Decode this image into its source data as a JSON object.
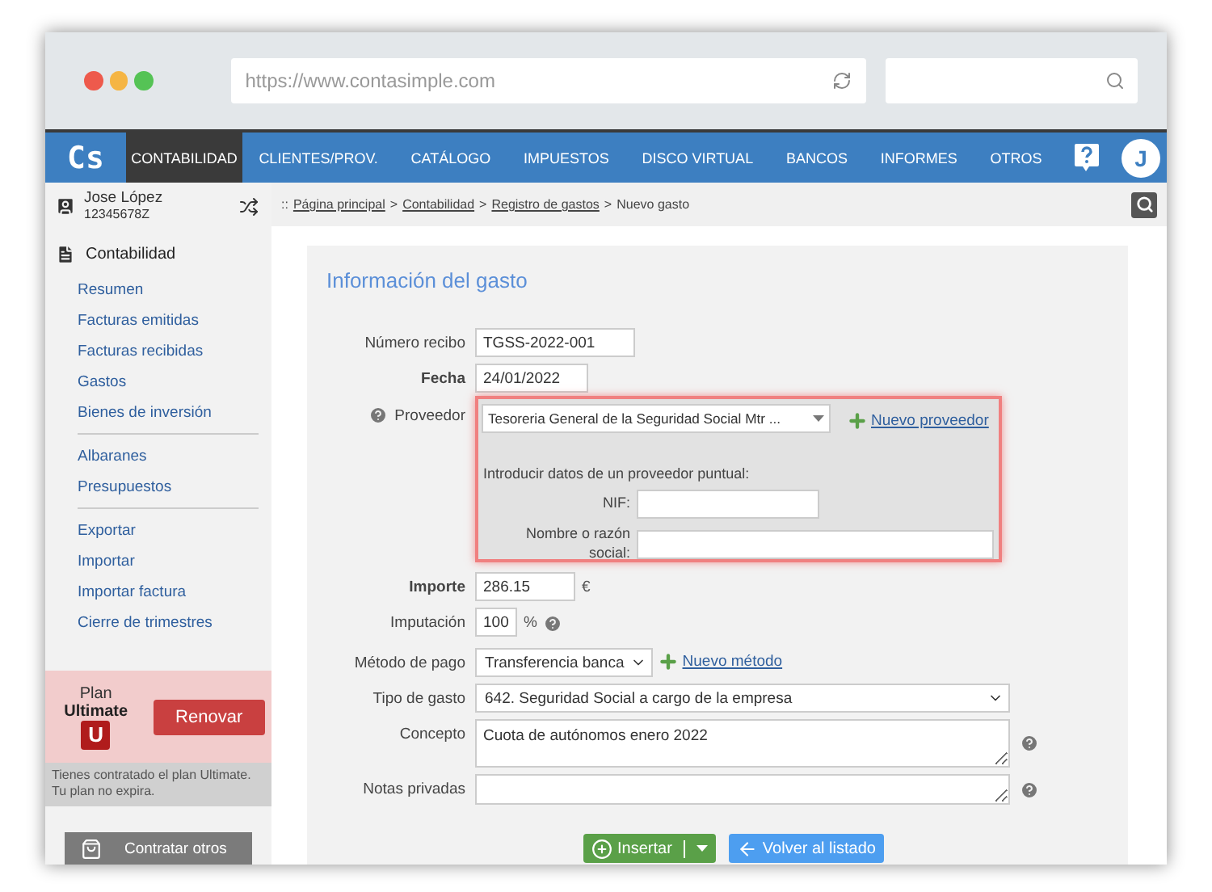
{
  "browser": {
    "url": "https://www.contasimple.com"
  },
  "nav": {
    "logo": "Cs",
    "items": [
      {
        "label": "CONTABILIDAD",
        "selected": true
      },
      {
        "label": "CLIENTES/PROV.",
        "selected": false
      },
      {
        "label": "CATÁLOGO",
        "selected": false
      },
      {
        "label": "IMPUESTOS",
        "selected": false
      },
      {
        "label": "DISCO VIRTUAL",
        "selected": false
      },
      {
        "label": "BANCOS",
        "selected": false
      },
      {
        "label": "INFORMES",
        "selected": false
      },
      {
        "label": "OTROS",
        "selected": false
      }
    ],
    "avatar": "J"
  },
  "user": {
    "name": "Jose López",
    "id": "12345678Z"
  },
  "sidebar": {
    "section": "Contabilidad",
    "groups": [
      [
        "Resumen",
        "Facturas emitidas",
        "Facturas recibidas",
        "Gastos",
        "Bienes de inversión"
      ],
      [
        "Albaranes",
        "Presupuestos"
      ],
      [
        "Exportar",
        "Importar",
        "Importar factura",
        "Cierre de trimestres"
      ]
    ]
  },
  "plan": {
    "label": "Plan",
    "name": "Ultimate",
    "badge": "U",
    "button": "Renovar",
    "note": "Tienes contratado el plan Ultimate. Tu plan no expira.",
    "contract": "Contratar otros"
  },
  "breadcrumb": {
    "prefix": "::",
    "separator": ">",
    "items": [
      {
        "label": "Página principal",
        "kind": "link"
      },
      {
        "label": "Contabilidad",
        "kind": "link"
      },
      {
        "label": "Registro de gastos",
        "kind": "link"
      },
      {
        "label": "Nuevo gasto",
        "kind": "current"
      }
    ]
  },
  "form": {
    "title": "Información del gasto",
    "fields": [
      {
        "label": "Número recibo",
        "bold": false,
        "kind": "text",
        "value": "TGSS-2022-001"
      },
      {
        "label": "Fecha",
        "bold": true,
        "kind": "date",
        "value": "24/01/2022"
      },
      {
        "label": "Proveedor",
        "bold": false,
        "kind": "provider",
        "help_icon": true,
        "value": "Tesoreria General de la Seguridad Social Mtr ...",
        "link": "Nuevo proveedor",
        "intro": "Introducir datos de un proveedor puntual:",
        "nif_label": "NIF:",
        "name_label": "Nombre o razón social:"
      },
      {
        "label": "Importe",
        "bold": true,
        "kind": "amount",
        "value": "286.15",
        "suffix": "€"
      },
      {
        "label": "Imputación",
        "bold": false,
        "kind": "percent",
        "value": "100",
        "suffix": "%",
        "help_icon": true
      },
      {
        "label": "Método de pago",
        "bold": false,
        "kind": "select-small",
        "value": "Transferencia banca",
        "link": "Nuevo método"
      },
      {
        "label": "Tipo de gasto",
        "bold": false,
        "kind": "select-wide",
        "value": "642. Seguridad Social a cargo de la empresa"
      },
      {
        "label": "Concepto",
        "bold": false,
        "kind": "textarea",
        "value": "Cuota de autónomos enero 2022",
        "help_icon": true
      },
      {
        "label": "Notas privadas",
        "bold": false,
        "kind": "textarea-small",
        "help_icon": true
      }
    ],
    "buttons": [
      {
        "label": "Insertar",
        "kind": "insert"
      },
      {
        "label": "Volver al listado",
        "kind": "back"
      }
    ]
  }
}
